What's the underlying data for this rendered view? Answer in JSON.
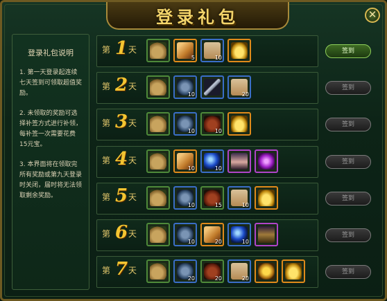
{
  "header": {
    "title": "登录礼包",
    "close_label": "✕"
  },
  "sidebar": {
    "title": "登录礼包说明",
    "paragraphs": [
      "1. 第一天登录起连续七天签到可领取超值奖励。",
      "2. 未领取的奖励可选择补签方式进行补领，每补签一次需要花费15元宝。",
      "3. 本界面将在领取完所有奖励或第九天登录时关闭，届时将无法领取剩余奖励。"
    ]
  },
  "days": [
    {
      "prefix": "第",
      "num": "1",
      "suffix": "天",
      "claim_label": "签到",
      "items": [
        {
          "icon": "bag-icon",
          "count": ""
        },
        {
          "icon": "scroll-icon",
          "count": "5"
        },
        {
          "icon": "map-icon",
          "count": "10"
        },
        {
          "icon": "gold-ingot-icon",
          "count": ""
        }
      ]
    },
    {
      "prefix": "第",
      "num": "2",
      "suffix": "天",
      "claim_label": "签到",
      "items": [
        {
          "icon": "bag-icon",
          "count": ""
        },
        {
          "icon": "token-icon",
          "count": "10"
        },
        {
          "icon": "sword-icon",
          "count": ""
        },
        {
          "icon": "map-icon",
          "count": "20"
        }
      ]
    },
    {
      "prefix": "第",
      "num": "3",
      "suffix": "天",
      "claim_label": "签到",
      "items": [
        {
          "icon": "bag-icon",
          "count": ""
        },
        {
          "icon": "token-icon",
          "count": "10"
        },
        {
          "icon": "jar-icon",
          "count": "10"
        },
        {
          "icon": "gold-ingot-icon",
          "count": ""
        }
      ]
    },
    {
      "prefix": "第",
      "num": "4",
      "suffix": "天",
      "claim_label": "签到",
      "items": [
        {
          "icon": "bag-icon",
          "count": ""
        },
        {
          "icon": "scroll-icon",
          "count": "10"
        },
        {
          "icon": "orb-icon",
          "count": "10"
        },
        {
          "icon": "portrait-icon",
          "count": ""
        },
        {
          "icon": "purple-gem-icon",
          "count": ""
        }
      ]
    },
    {
      "prefix": "第",
      "num": "5",
      "suffix": "天",
      "claim_label": "签到",
      "items": [
        {
          "icon": "bag-icon",
          "count": ""
        },
        {
          "icon": "token-icon",
          "count": "10"
        },
        {
          "icon": "jar-icon",
          "count": "15"
        },
        {
          "icon": "map-icon",
          "count": "10"
        },
        {
          "icon": "gold-ingot-icon",
          "count": ""
        }
      ]
    },
    {
      "prefix": "第",
      "num": "6",
      "suffix": "天",
      "claim_label": "签到",
      "items": [
        {
          "icon": "bag-icon",
          "count": ""
        },
        {
          "icon": "token-icon",
          "count": "10"
        },
        {
          "icon": "scroll-icon",
          "count": "20"
        },
        {
          "icon": "orb-icon",
          "count": "10"
        },
        {
          "icon": "warrior-icon",
          "count": ""
        }
      ]
    },
    {
      "prefix": "第",
      "num": "7",
      "suffix": "天",
      "claim_label": "签到",
      "items": [
        {
          "icon": "bag-icon",
          "count": ""
        },
        {
          "icon": "token-icon",
          "count": "20"
        },
        {
          "icon": "jar-icon",
          "count": "20"
        },
        {
          "icon": "map-icon",
          "count": "20"
        },
        {
          "icon": "coin-icon",
          "count": ""
        },
        {
          "icon": "gold-ingot-icon",
          "count": ""
        }
      ]
    }
  ]
}
